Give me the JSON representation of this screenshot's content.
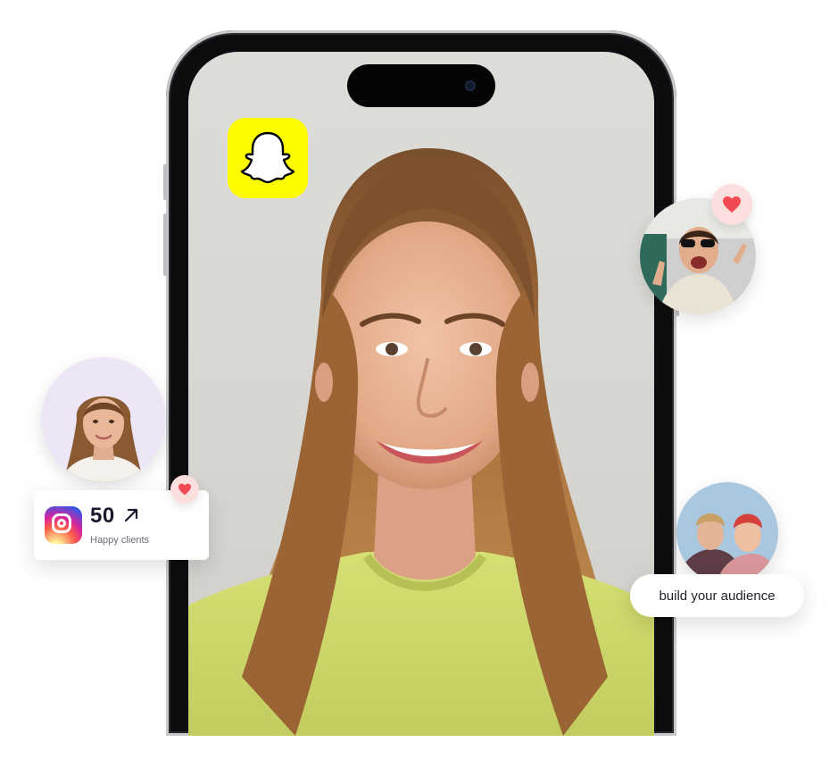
{
  "snapchat": {
    "icon": "snapchat-ghost-icon",
    "bg": "#fffc00"
  },
  "stats_card": {
    "icon": "instagram-icon",
    "value": "50",
    "arrow_icon": "arrow-up-right-icon",
    "label": "Happy clients"
  },
  "audience_pill": {
    "label": "build your audience"
  },
  "heart_icon": "heart-icon",
  "colors": {
    "heart": "#f04b54",
    "badge_bg": "#fbdede",
    "shirt": "#cfd86a"
  }
}
